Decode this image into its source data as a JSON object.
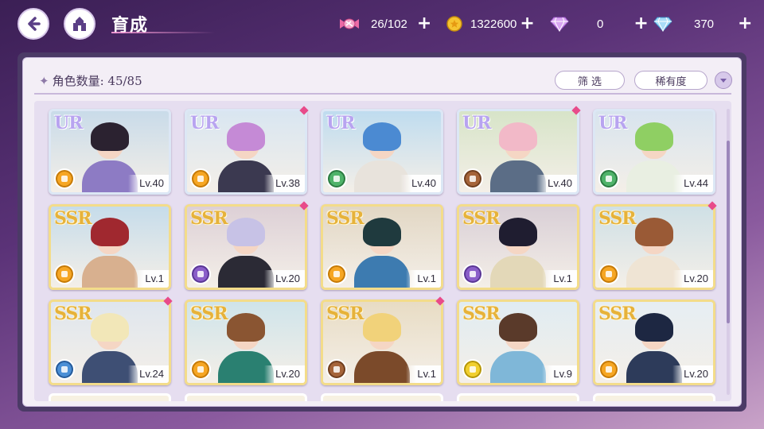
{
  "header": {
    "title": "育成",
    "back_icon": "back-arrow-icon",
    "home_icon": "castle-home-icon"
  },
  "resources": {
    "stamina": {
      "icon": "candy-icon",
      "value": "26/102",
      "plus": "+"
    },
    "gold": {
      "icon": "gold-coin-icon",
      "value": "1322600",
      "plus": "+"
    },
    "paid_gem": {
      "icon": "pink-diamond-icon",
      "value": "0",
      "plus": "+"
    },
    "free_gem": {
      "icon": "blue-diamond-icon",
      "value": "370",
      "plus": "+"
    }
  },
  "roster": {
    "count_label": "角色数量: 45/85",
    "filter_label": "筛 选",
    "sort_label": "稀有度",
    "sort_direction_icon": "chevron-down-icon"
  },
  "colors": {
    "ur_border": "#dce7f5",
    "ssr_border": "#f3dc8a",
    "new_marker": "#e84b8a"
  },
  "cards": [
    {
      "rarity": "UR",
      "level": "Lv.40",
      "attr": "orange",
      "new": false,
      "hair": "#2b2230",
      "outfit": "#8d7bc4",
      "bg": "#c9dbe9"
    },
    {
      "rarity": "UR",
      "level": "Lv.38",
      "attr": "orange",
      "new": true,
      "hair": "#c58ad6",
      "outfit": "#3b3950",
      "bg": "#d9e6f1"
    },
    {
      "rarity": "UR",
      "level": "Lv.40",
      "attr": "green",
      "new": false,
      "hair": "#4b8ad2",
      "outfit": "#e8e3dc",
      "bg": "#bfdcef"
    },
    {
      "rarity": "UR",
      "level": "Lv.40",
      "attr": "brown",
      "new": true,
      "hair": "#f2b9c8",
      "outfit": "#5b6d86",
      "bg": "#d7e4c8"
    },
    {
      "rarity": "UR",
      "level": "Lv.44",
      "attr": "green",
      "new": false,
      "hair": "#8fcf63",
      "outfit": "#e9efe2",
      "bg": "#d8e4ee"
    },
    {
      "rarity": "SSR",
      "level": "Lv.1",
      "attr": "orange",
      "new": false,
      "hair": "#a0282f",
      "outfit": "#d8b08f",
      "bg": "#c6dcea"
    },
    {
      "rarity": "SSR",
      "level": "Lv.20",
      "attr": "purple",
      "new": true,
      "hair": "#c7c2e6",
      "outfit": "#2b2a35",
      "bg": "#ddd0d6"
    },
    {
      "rarity": "SSR",
      "level": "Lv.1",
      "attr": "orange",
      "new": false,
      "hair": "#1f3a3e",
      "outfit": "#3d7bb0",
      "bg": "#e2d7c4"
    },
    {
      "rarity": "SSR",
      "level": "Lv.1",
      "attr": "purple",
      "new": false,
      "hair": "#1f1d30",
      "outfit": "#e3d8b8",
      "bg": "#d9cfd6"
    },
    {
      "rarity": "SSR",
      "level": "Lv.20",
      "attr": "orange",
      "new": true,
      "hair": "#9a5a36",
      "outfit": "#efe4d4",
      "bg": "#cfe0e6"
    },
    {
      "rarity": "SSR",
      "level": "Lv.24",
      "attr": "blue",
      "new": true,
      "hair": "#f2e7b8",
      "outfit": "#3e4f74",
      "bg": "#dfe6ee"
    },
    {
      "rarity": "SSR",
      "level": "Lv.20",
      "attr": "orange",
      "new": false,
      "hair": "#8a5532",
      "outfit": "#2a8071",
      "bg": "#cfe4ea"
    },
    {
      "rarity": "SSR",
      "level": "Lv.1",
      "attr": "brown",
      "new": true,
      "hair": "#f1d27a",
      "outfit": "#7b4a2a",
      "bg": "#e8dcc4"
    },
    {
      "rarity": "SSR",
      "level": "Lv.9",
      "attr": "yellow",
      "new": false,
      "hair": "#5a3a2a",
      "outfit": "#7fb7d8",
      "bg": "#e0ecf2"
    },
    {
      "rarity": "SSR",
      "level": "Lv.20",
      "attr": "orange",
      "new": false,
      "hair": "#1d2742",
      "outfit": "#2d3b5a",
      "bg": "#e6eef3"
    }
  ]
}
